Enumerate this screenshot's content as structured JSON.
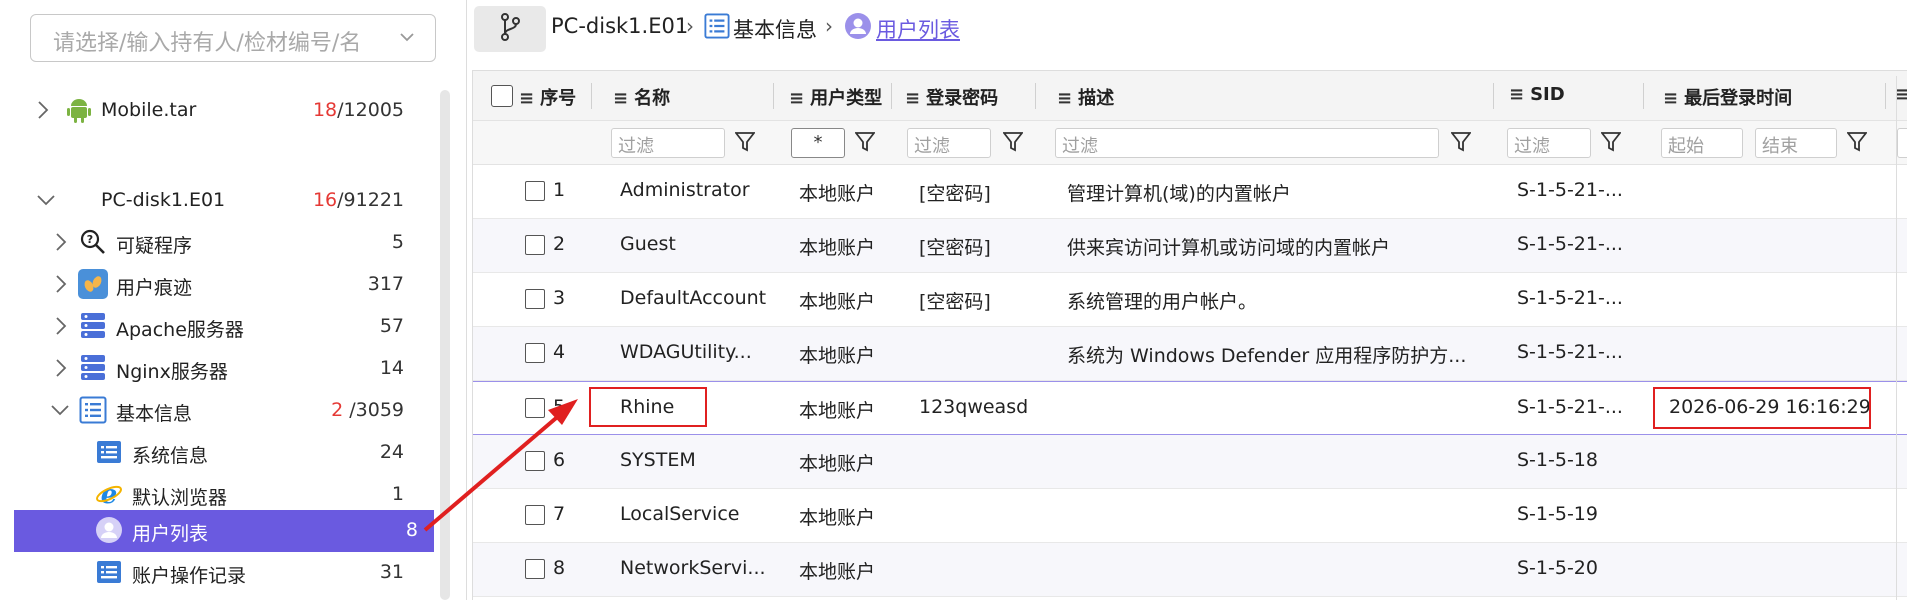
{
  "search": {
    "placeholder": "请选择/输入持有人/检材编号/名"
  },
  "tree": [
    {
      "label": "Mobile.tar",
      "count_red": "18",
      "count_rest": "/12005",
      "icon": "android-icon"
    },
    {
      "label": "PC-disk1.E01",
      "count_red": "16",
      "count_rest": "/91221",
      "icon": "windows-icon"
    },
    {
      "label": "可疑程序",
      "count_red": "",
      "count_rest": "5",
      "icon": "search-question-icon"
    },
    {
      "label": "用户痕迹",
      "count_red": "",
      "count_rest": "317",
      "icon": "footprints-icon"
    },
    {
      "label": "Apache服务器",
      "count_red": "",
      "count_rest": "57",
      "icon": "server-icon"
    },
    {
      "label": "Nginx服务器",
      "count_red": "",
      "count_rest": "14",
      "icon": "server-icon"
    },
    {
      "label": "基本信息",
      "count_red": "2",
      "count_rest": " /3059",
      "icon": "list-icon"
    },
    {
      "label": "系统信息",
      "count_red": "",
      "count_rest": "24",
      "icon": "system-info-icon"
    },
    {
      "label": "默认浏览器",
      "count_red": "",
      "count_rest": "1",
      "icon": "ie-browser-icon"
    },
    {
      "label": "用户列表",
      "count_red": "",
      "count_rest": "8",
      "icon": "user-icon"
    },
    {
      "label": "账户操作记录",
      "count_red": "",
      "count_rest": "31",
      "icon": "account-log-icon"
    }
  ],
  "breadcrumb": {
    "root": "PC-disk1.E01",
    "mid": "基本信息",
    "current": "用户列表"
  },
  "columns": [
    "序号",
    "名称",
    "用户类型",
    "登录密码",
    "描述",
    "SID",
    "最后登录时间"
  ],
  "filters": {
    "placeholder": "过滤",
    "user_type_value": "*",
    "start_placeholder": "起始",
    "end_placeholder": "结束"
  },
  "rows": [
    {
      "no": "1",
      "name": "Administrator",
      "type": "本地账户",
      "pwd": "[空密码]",
      "desc": "管理计算机(域)的内置帐户",
      "sid": "S-1-5-21-...",
      "last": ""
    },
    {
      "no": "2",
      "name": "Guest",
      "type": "本地账户",
      "pwd": "[空密码]",
      "desc": "供来宾访问计算机或访问域的内置帐户",
      "sid": "S-1-5-21-...",
      "last": ""
    },
    {
      "no": "3",
      "name": "DefaultAccount",
      "type": "本地账户",
      "pwd": "[空密码]",
      "desc": "系统管理的用户帐户。",
      "sid": "S-1-5-21-...",
      "last": ""
    },
    {
      "no": "4",
      "name": "WDAGUtility...",
      "type": "本地账户",
      "pwd": "",
      "desc": "系统为 Windows Defender 应用程序防护方...",
      "sid": "S-1-5-21-...",
      "last": ""
    },
    {
      "no": "5",
      "name": "Rhine",
      "type": "本地账户",
      "pwd": "123qweasd",
      "desc": "",
      "sid": "S-1-5-21-...",
      "last": "2026-06-29 16:16:29"
    },
    {
      "no": "6",
      "name": "SYSTEM",
      "type": "本地账户",
      "pwd": "",
      "desc": "",
      "sid": "S-1-5-18",
      "last": ""
    },
    {
      "no": "7",
      "name": "LocalService",
      "type": "本地账户",
      "pwd": "",
      "desc": "",
      "sid": "S-1-5-19",
      "last": ""
    },
    {
      "no": "8",
      "name": "NetworkServi...",
      "type": "本地账户",
      "pwd": "",
      "desc": "",
      "sid": "S-1-5-20",
      "last": ""
    }
  ],
  "colors": {
    "accent": "#6a5ae0",
    "highlight": "#e02020"
  }
}
